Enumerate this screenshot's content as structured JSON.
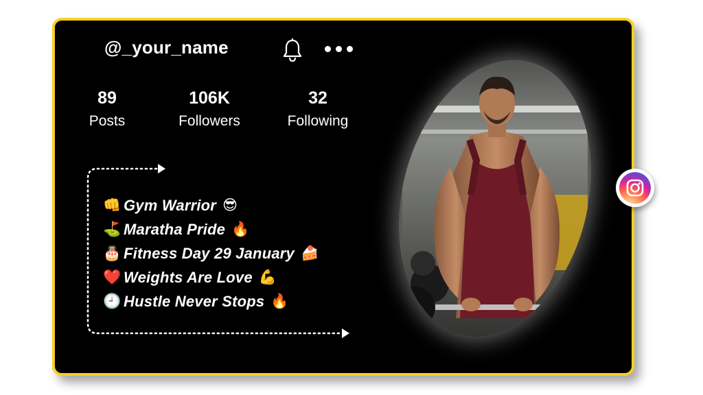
{
  "profile": {
    "username": "@_your_name"
  },
  "icons": {
    "notifications": "bell-icon",
    "more": "more-dots-icon",
    "social": "instagram-icon"
  },
  "stats": [
    {
      "value": "89",
      "label": "Posts"
    },
    {
      "value": "106K",
      "label": "Followers"
    },
    {
      "value": "32",
      "label": "Following"
    }
  ],
  "bio": [
    {
      "lead": "👊",
      "text": "Gym Warrior",
      "trail": "😎"
    },
    {
      "lead": "⛳",
      "text": "Maratha Pride",
      "trail": "🔥"
    },
    {
      "lead": "🎂",
      "text": "Fitness Day 29 January",
      "trail": "🍰"
    },
    {
      "lead": "❤️",
      "text": "Weights Are Love",
      "trail": "💪"
    },
    {
      "lead": "🕘",
      "text": "Hustle Never Stops",
      "trail": "🔥"
    }
  ],
  "colors": {
    "card_border": "#f6cf26",
    "card_background": "#000000",
    "text": "#ffffff",
    "shirt": "#6e1b27"
  }
}
